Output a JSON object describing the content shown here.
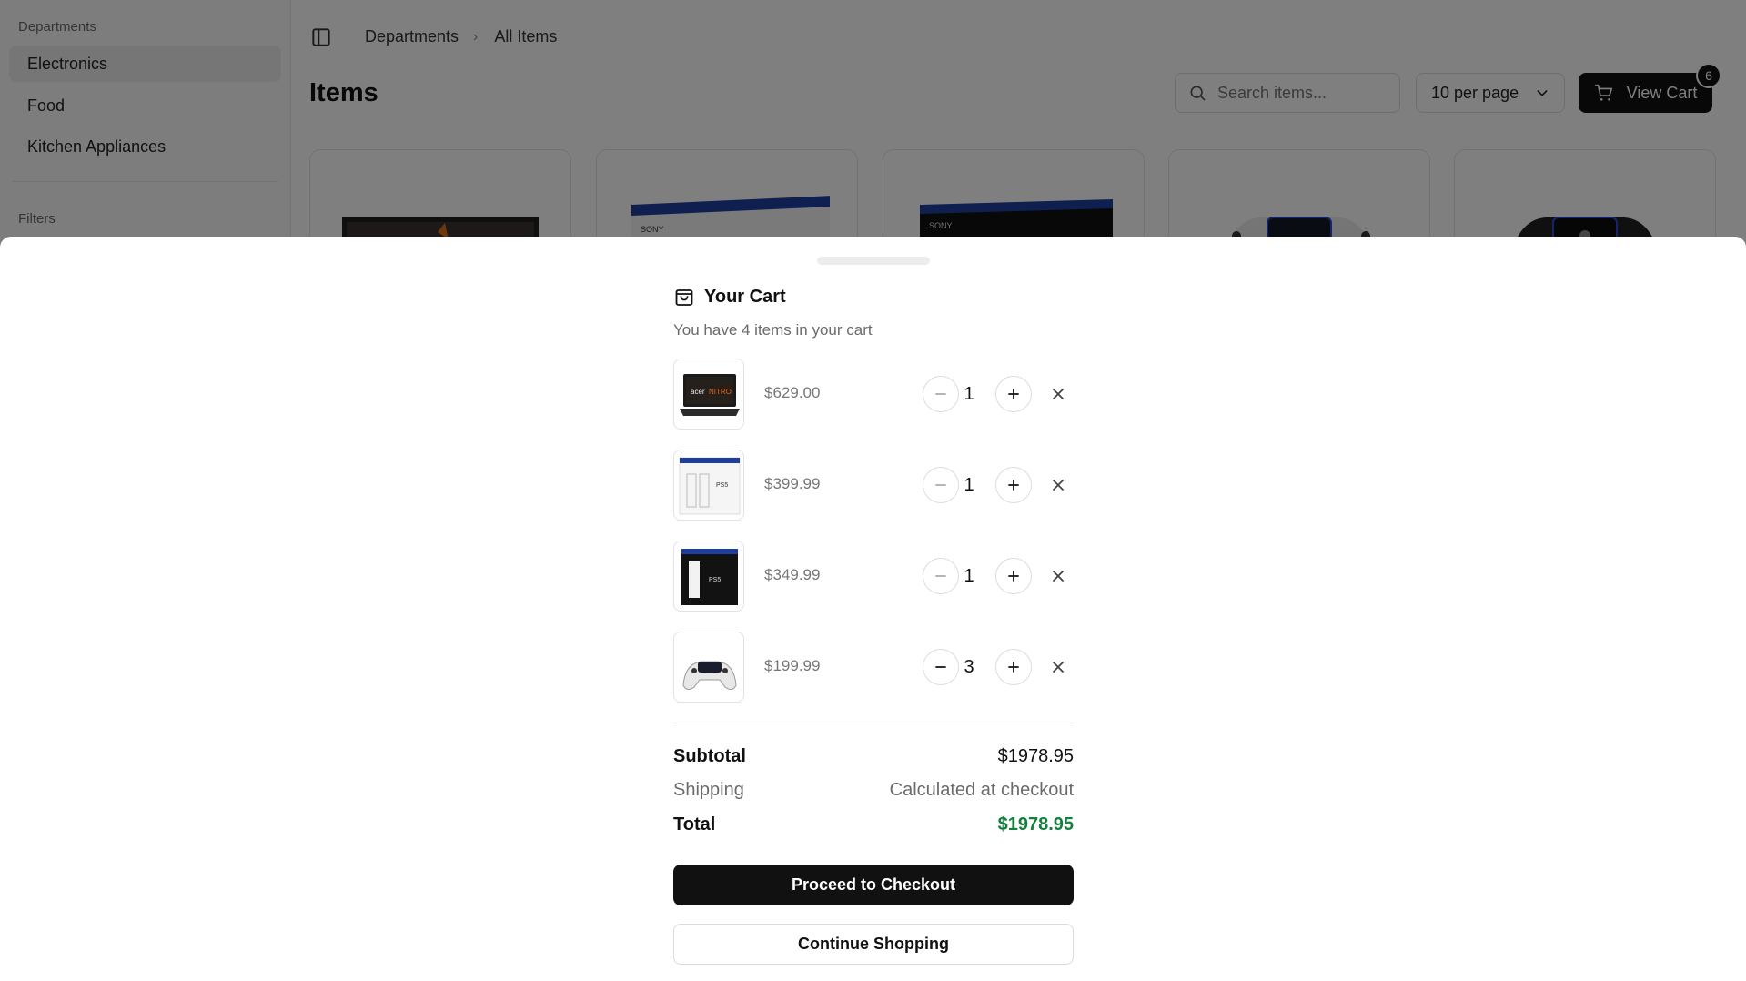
{
  "sidebar": {
    "departments_label": "Departments",
    "items": [
      {
        "label": "Electronics",
        "active": true
      },
      {
        "label": "Food",
        "active": false
      },
      {
        "label": "Kitchen Appliances",
        "active": false
      }
    ],
    "filters_label": "Filters"
  },
  "header": {
    "breadcrumb": [
      "Departments",
      "All Items"
    ],
    "title": "Items",
    "search_placeholder": "Search items...",
    "per_page": "10 per page",
    "view_cart_label": "View Cart",
    "cart_badge": "6"
  },
  "cart": {
    "title": "Your Cart",
    "subtitle": "You have 4 items in your cart",
    "items": [
      {
        "price": "$629.00",
        "qty": "1",
        "image": "laptop"
      },
      {
        "price": "$399.99",
        "qty": "1",
        "image": "console-white-box"
      },
      {
        "price": "$349.99",
        "qty": "1",
        "image": "console-black-box"
      },
      {
        "price": "$199.99",
        "qty": "3",
        "image": "controller"
      }
    ],
    "summary": {
      "subtotal_label": "Subtotal",
      "subtotal_value": "$1978.95",
      "shipping_label": "Shipping",
      "shipping_value": "Calculated at checkout",
      "total_label": "Total",
      "total_value": "$1978.95"
    },
    "checkout_label": "Proceed to Checkout",
    "continue_label": "Continue Shopping"
  },
  "colors": {
    "total_green": "#15803d",
    "primary": "#111111",
    "overlay": "rgba(0,0,0,0.5)"
  }
}
